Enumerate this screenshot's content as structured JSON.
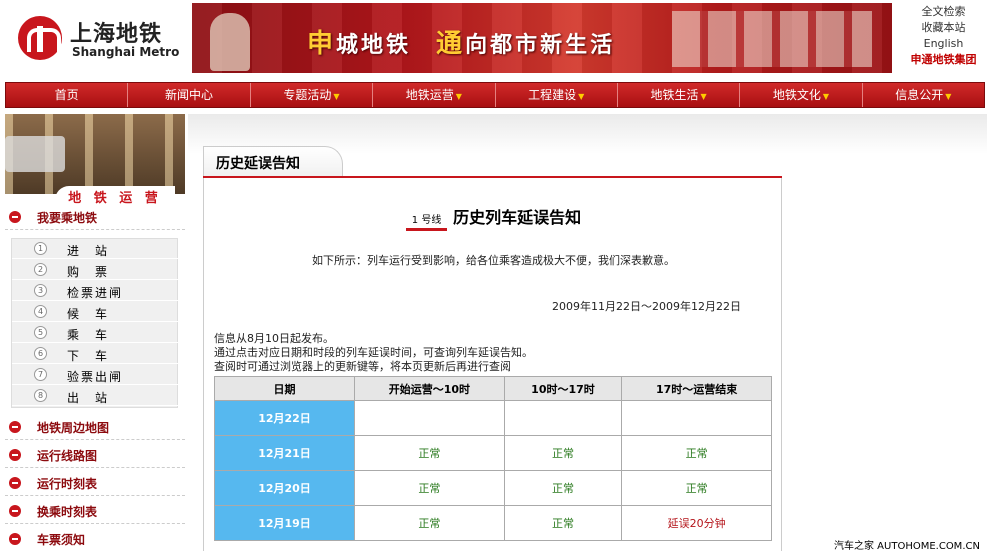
{
  "header": {
    "logo_cn": "上海地铁",
    "logo_en": "Shanghai Metro",
    "banner": {
      "slogan_1": "申",
      "slogan_2": "城地铁",
      "slogan_3": "通",
      "slogan_4": "向都市新生活"
    },
    "links": [
      "全文检索",
      "收藏本站",
      "English",
      "申通地铁集团"
    ]
  },
  "nav": {
    "items": [
      {
        "label": "首页",
        "dropdown": false
      },
      {
        "label": "新闻中心",
        "dropdown": false
      },
      {
        "label": "专题活动",
        "dropdown": true
      },
      {
        "label": "地铁运营",
        "dropdown": true
      },
      {
        "label": "工程建设",
        "dropdown": true
      },
      {
        "label": "地铁生活",
        "dropdown": true
      },
      {
        "label": "地铁文化",
        "dropdown": true
      },
      {
        "label": "信息公开",
        "dropdown": true
      }
    ]
  },
  "sidebar": {
    "section_title": "地 铁 运 营",
    "ride_header": "我要乘地铁",
    "steps": [
      {
        "num": "1",
        "label": "进　站"
      },
      {
        "num": "2",
        "label": "购　票"
      },
      {
        "num": "3",
        "label": "检票进闸"
      },
      {
        "num": "4",
        "label": "候　车"
      },
      {
        "num": "5",
        "label": "乘　车"
      },
      {
        "num": "6",
        "label": "下　车"
      },
      {
        "num": "7",
        "label": "验票出闸"
      },
      {
        "num": "8",
        "label": "出　站"
      }
    ],
    "links": [
      "地铁周边地图",
      "运行线路图",
      "运行时刻表",
      "换乘时刻表",
      "车票须知"
    ]
  },
  "main": {
    "tab_title": "历史延误告知",
    "line_label": "1 号线",
    "headline": "历史列车延误告知",
    "notice": "如下所示：列车运行受到影响，给各位乘客造成极大不便，我们深表歉意。",
    "date_range": "2009年11月22日～2009年12月22日",
    "info_lines": [
      "信息从8月10日起发布。",
      "通过点击对应日期和时段的列车延误时间，可查询列车延误告知。",
      "查阅时可通过浏览器上的更新键等，将本页更新后再进行查阅"
    ],
    "table": {
      "headers": [
        "日期",
        "开始运营～10时",
        "10时～17时",
        "17时～运营结束"
      ],
      "rows": [
        {
          "date": "12月22日",
          "c1": "",
          "c2": "",
          "c3": ""
        },
        {
          "date": "12月21日",
          "c1": "正常",
          "c2": "正常",
          "c3": "正常"
        },
        {
          "date": "12月20日",
          "c1": "正常",
          "c2": "正常",
          "c3": "正常"
        },
        {
          "date": "12月19日",
          "c1": "正常",
          "c2": "正常",
          "c3": "延误20分钟"
        }
      ]
    }
  },
  "watermark": "汽车之家 AUTOHOME.COM.CN"
}
